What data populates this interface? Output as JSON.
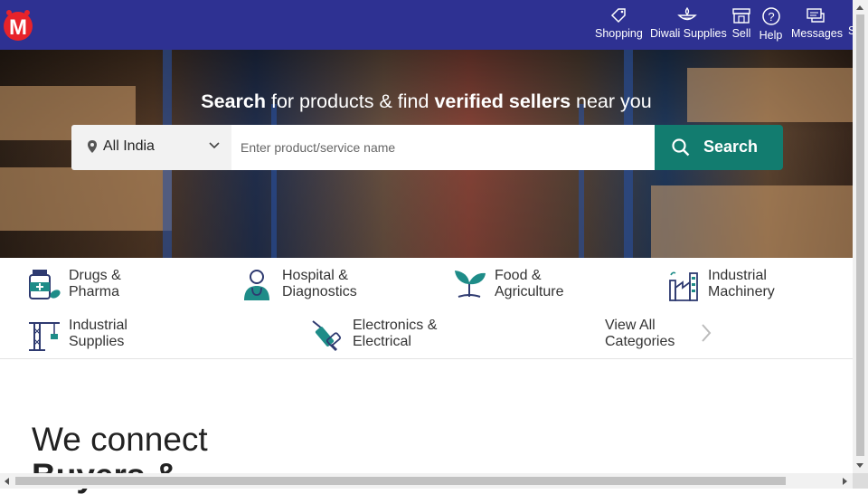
{
  "header": {
    "logo_letter": "M",
    "nav": [
      {
        "label": "Shopping",
        "icon": "tag-icon"
      },
      {
        "label": "Diwali Supplies",
        "icon": "diya-icon"
      },
      {
        "label": "Sell",
        "icon": "store-icon"
      },
      {
        "label": "Help",
        "icon": "help-icon"
      },
      {
        "label": "Messages",
        "icon": "messages-icon"
      },
      {
        "label": "S"
      }
    ]
  },
  "hero": {
    "title_bold1": "Search",
    "title_mid": " for products & find ",
    "title_bold2": "verified sellers",
    "title_end": " near you",
    "location": "All India",
    "search_placeholder": "Enter product/service name",
    "search_button": "Search"
  },
  "categories": [
    {
      "line1": "Drugs &",
      "line2": "Pharma",
      "icon": "medicine-bottle-icon"
    },
    {
      "line1": "Hospital &",
      "line2": "Diagnostics",
      "icon": "doctor-icon"
    },
    {
      "line1": "Food &",
      "line2": "Agriculture",
      "icon": "sprout-icon"
    },
    {
      "line1": "Industrial",
      "line2": "Machinery",
      "icon": "factory-icon"
    },
    {
      "line1": "Industrial",
      "line2": "Supplies",
      "icon": "crane-icon"
    },
    {
      "line1": "Electronics &",
      "line2": "Electrical",
      "icon": "drill-icon"
    },
    {
      "line1": "View All",
      "line2": "Categories",
      "icon": "chevron-right-icon"
    }
  ],
  "main": {
    "headline_line1": "We connect",
    "headline_line2": "Buyers &"
  },
  "colors": {
    "header_bg": "#2e3192",
    "search_button_bg": "#127c6f",
    "icon_teal": "#1e8c88",
    "icon_navy": "#2e3a70"
  }
}
